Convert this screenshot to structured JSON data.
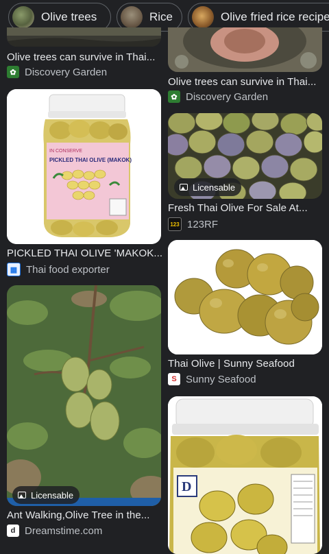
{
  "chips": [
    {
      "label": "Olive trees",
      "thumb": "olive-trees-thumbnail"
    },
    {
      "label": "Rice",
      "thumb": "rice-thumbnail"
    },
    {
      "label": "Olive fried rice recipe",
      "thumb": "olive-fried-rice-thumbnail"
    }
  ],
  "results": {
    "left": [
      {
        "title": "Olive trees can survive in Thai...",
        "source": "Discovery Garden",
        "favicon": "discovery-garden-icon"
      },
      {
        "title": "PICKLED THAI OLIVE 'MAKOK...",
        "source": "Thai food exporter",
        "favicon": "thai-food-exporter-icon",
        "jar_label": "PICKLED THAI OLIVE (MAKOK)",
        "jar_brand": "IN CONSERVE"
      },
      {
        "title": "Ant Walking,Olive Tree in the...",
        "source": "Dreamstime.com",
        "favicon": "dreamstime-icon",
        "badge": "Licensable"
      }
    ],
    "right": [
      {
        "title": "Olive trees can survive in Thai...",
        "source": "Discovery Garden",
        "favicon": "discovery-garden-icon"
      },
      {
        "title": "Fresh Thai Olive For Sale At...",
        "source": "123RF",
        "favicon": "123rf-icon",
        "badge": "Licensable",
        "favicon_text": "123"
      },
      {
        "title": "Thai Olive | Sunny Seafood",
        "source": "Sunny Seafood",
        "favicon": "sunny-seafood-icon",
        "favicon_text": "S"
      },
      {
        "title": "",
        "source": "",
        "favicon": "",
        "jar_brand": "D"
      }
    ]
  },
  "colors": {
    "background": "#202124",
    "text": "#e8eaed",
    "muted": "#bdc1c6",
    "chip_border": "#5f6368"
  }
}
